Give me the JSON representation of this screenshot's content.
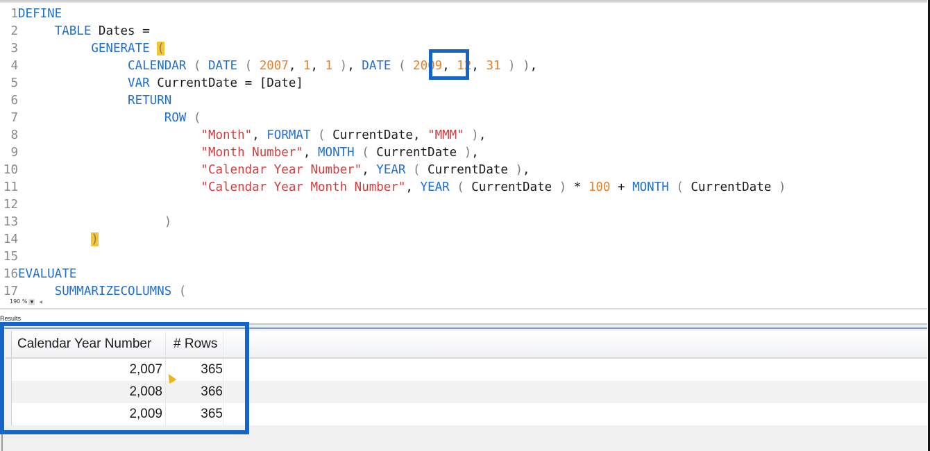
{
  "editor": {
    "zoom_level": "190 %",
    "lines": [
      {
        "n": "1"
      },
      {
        "n": "2"
      },
      {
        "n": "3"
      },
      {
        "n": "4"
      },
      {
        "n": "5"
      },
      {
        "n": "6"
      },
      {
        "n": "7"
      },
      {
        "n": "8"
      },
      {
        "n": "9"
      },
      {
        "n": "10"
      },
      {
        "n": "11"
      },
      {
        "n": "12"
      },
      {
        "n": "13"
      },
      {
        "n": "14"
      },
      {
        "n": "15"
      },
      {
        "n": "16"
      },
      {
        "n": "17"
      }
    ],
    "tokens": {
      "define": "DEFINE",
      "table": "TABLE",
      "dates": " Dates =",
      "generate": "GENERATE",
      "open_paren": "(",
      "calendar": "CALENDAR",
      "date": "DATE",
      "y1": "2007",
      "m1": "1",
      "d1": "1",
      "y2": "2009",
      "m2": "12",
      "d2": "31",
      "var": "VAR",
      "var_rest": " CurrentDate = [Date]",
      "return": "RETURN",
      "row": "ROW",
      "s_month": "\"Month\"",
      "format": "FORMAT",
      "cd": "CurrentDate",
      "s_mmm": "\"MMM\"",
      "s_month_number": "\"Month Number\"",
      "month": "MONTH",
      "s_cal_year_number": "\"Calendar Year Number\"",
      "year": "YEAR",
      "s_cal_year_month_number": "\"Calendar Year Month Number\"",
      "n100": "100",
      "close_paren": ")",
      "evaluate": "EVALUATE",
      "summarizecolumns": "SUMMARIZECOLUMNS"
    }
  },
  "results": {
    "label": "Results",
    "columns": [
      "Calendar Year Number",
      "# Rows"
    ],
    "rows": [
      [
        "2,007",
        "365"
      ],
      [
        "2,008",
        "366"
      ],
      [
        "2,009",
        "365"
      ]
    ]
  },
  "colors": {
    "keyword": "#1f6fd1",
    "string": "#d63b3b",
    "number": "#e8802a",
    "bracket_highlight": "#f7c530",
    "callout": "#1565c8"
  }
}
